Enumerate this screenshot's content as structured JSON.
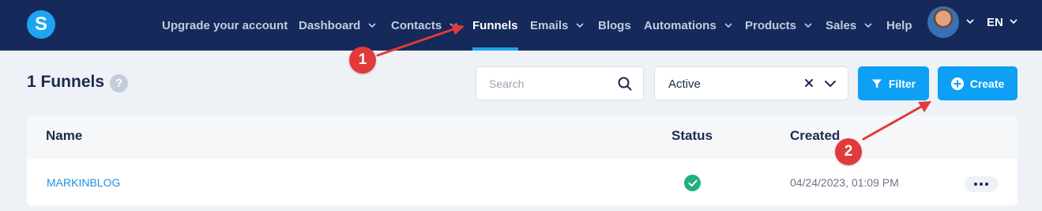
{
  "brand": {
    "logo_letter": "S"
  },
  "nav": {
    "items": [
      {
        "label": "Upgrade your account",
        "has_caret": false,
        "active": false
      },
      {
        "label": "Dashboard",
        "has_caret": true,
        "active": false
      },
      {
        "label": "Contacts",
        "has_caret": true,
        "active": false
      },
      {
        "label": "Funnels",
        "has_caret": false,
        "active": true
      },
      {
        "label": "Emails",
        "has_caret": true,
        "active": false
      },
      {
        "label": "Blogs",
        "has_caret": false,
        "active": false
      },
      {
        "label": "Automations",
        "has_caret": true,
        "active": false
      },
      {
        "label": "Products",
        "has_caret": true,
        "active": false
      },
      {
        "label": "Sales",
        "has_caret": true,
        "active": false
      },
      {
        "label": "Help",
        "has_caret": false,
        "active": false
      }
    ],
    "language": "EN"
  },
  "page": {
    "title": "1 Funnels",
    "help_icon_glyph": "?"
  },
  "controls": {
    "search_placeholder": "Search",
    "status_filter_value": "Active",
    "filter_label": "Filter",
    "create_label": "Create"
  },
  "table": {
    "headers": {
      "name": "Name",
      "status": "Status",
      "created": "Created"
    },
    "rows": [
      {
        "name": "MARKINBLOG",
        "status": "ok",
        "created": "04/24/2023, 01:09 PM"
      }
    ]
  },
  "annotations": [
    {
      "number": "1"
    },
    {
      "number": "2"
    }
  ],
  "colors": {
    "nav_bg": "#15295a",
    "accent": "#0ea0f4",
    "status_ok": "#22b07d",
    "annotation": "#e23a3a"
  }
}
